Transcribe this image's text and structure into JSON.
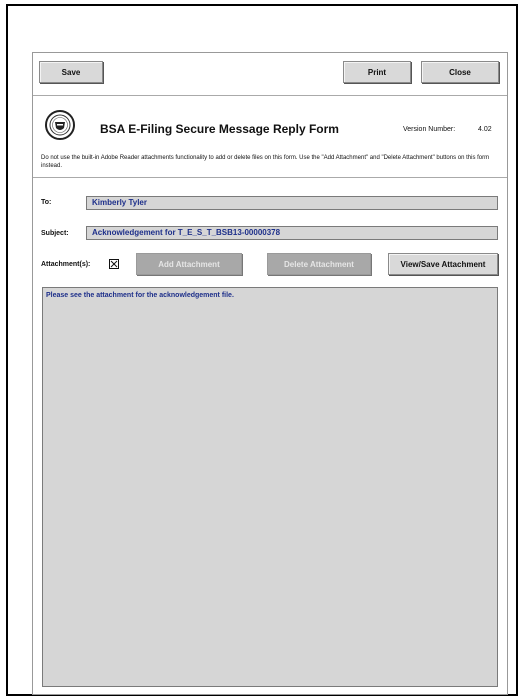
{
  "toolbar": {
    "save_label": "Save",
    "print_label": "Print",
    "close_label": "Close"
  },
  "header": {
    "title": "BSA E-Filing Secure Message Reply Form",
    "version_label": "Version Number:",
    "version_value": "4.02",
    "notice": "Do not use the built-in Adobe Reader attachments functionality to add or delete files on this form. Use the \"Add Attachment\" and \"Delete Attachment\" buttons on this form instead."
  },
  "fields": {
    "to_label": "To:",
    "to_value": "Kimberly Tyler",
    "subject_label": "Subject:",
    "subject_value": "Acknowledgement for T_E_S_T_BSB13-00000378",
    "attachments_label": "Attachment(s):",
    "attachment_checked": true
  },
  "attachment_buttons": {
    "add_label": "Add Attachment",
    "delete_label": "Delete Attachment",
    "view_save_label": "View/Save Attachment"
  },
  "message": {
    "body": "Please see the attachment for the acknowledgement file."
  }
}
